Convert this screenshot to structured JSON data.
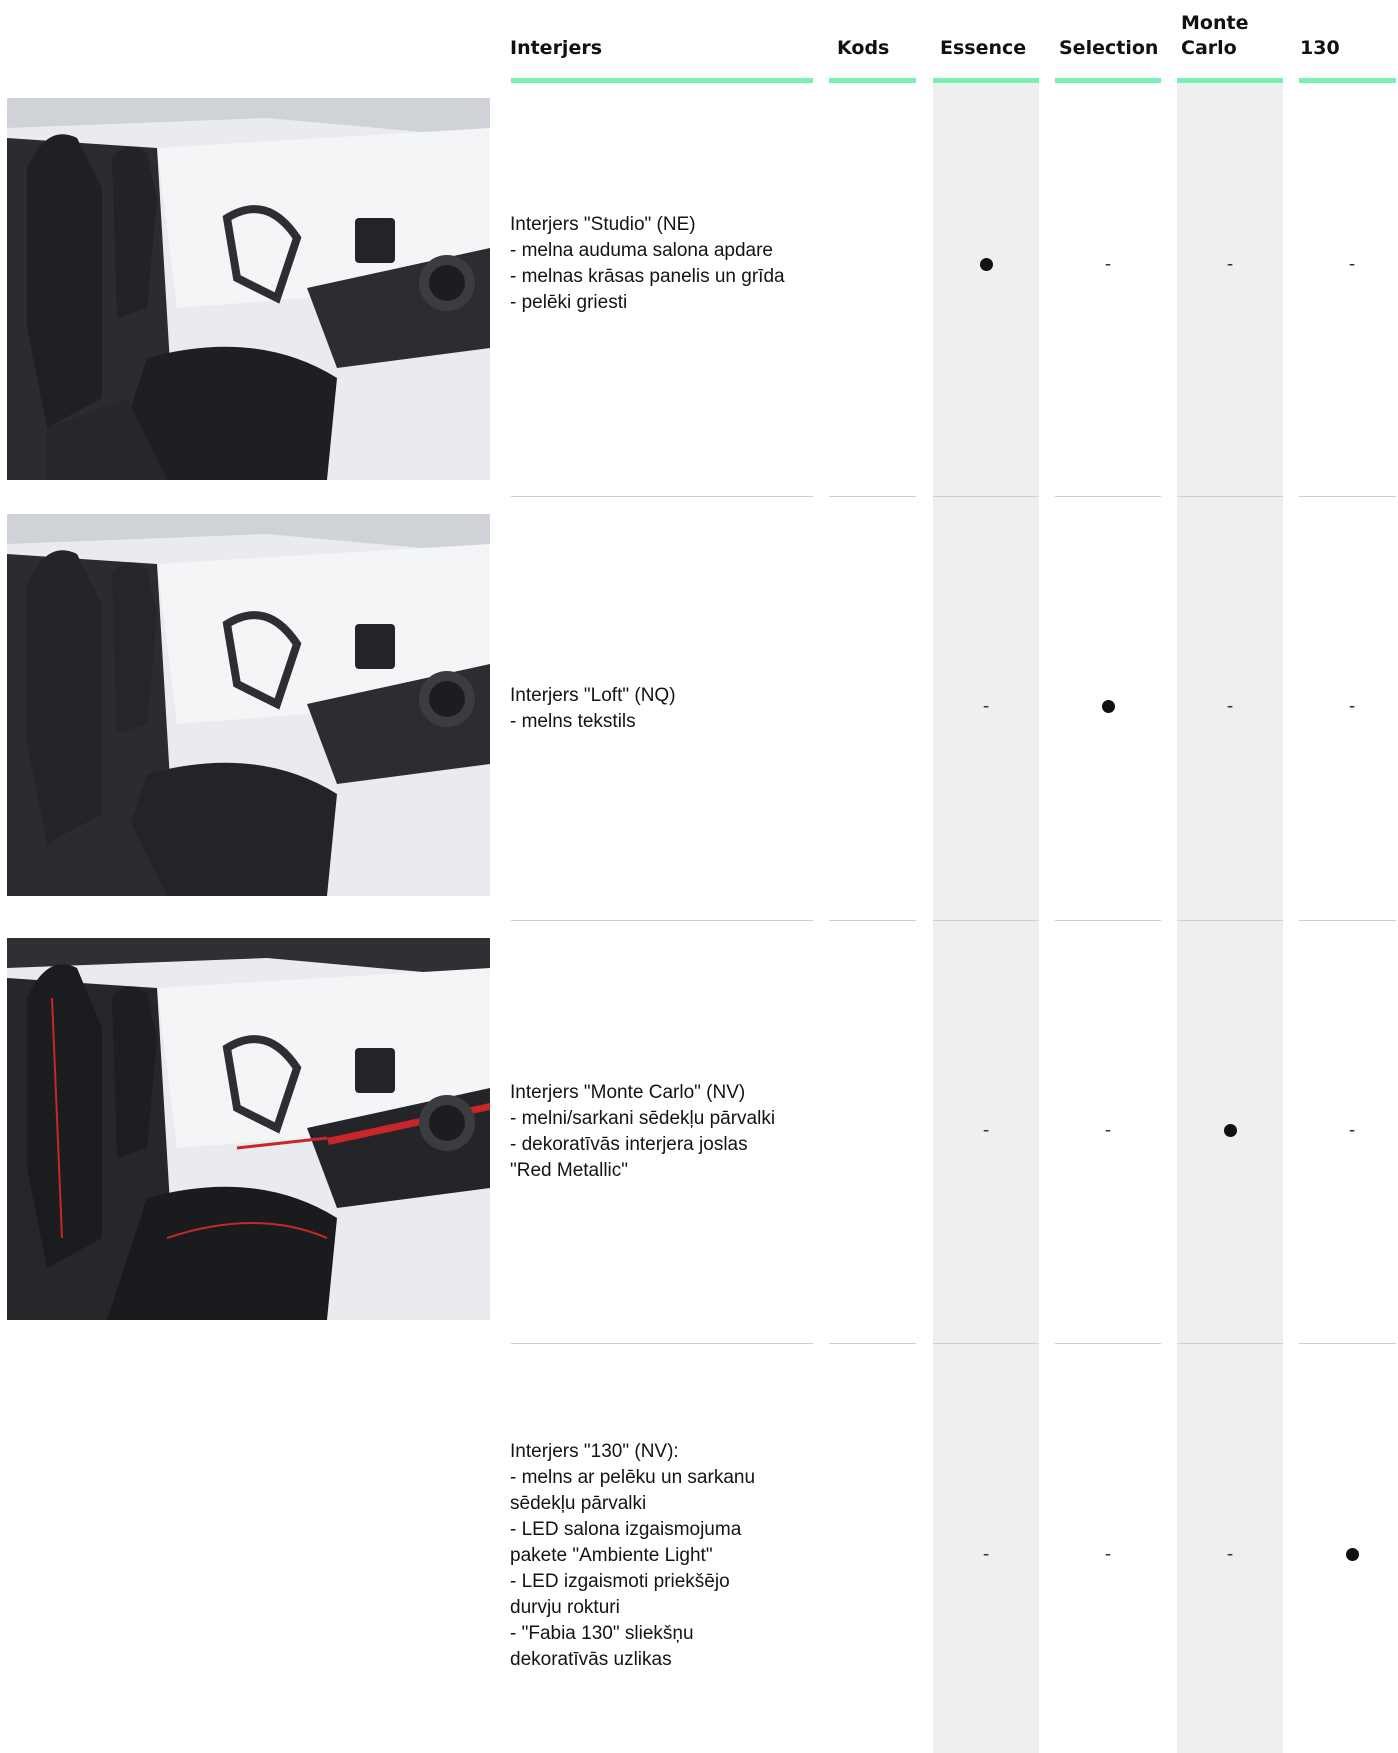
{
  "header": {
    "interior": "Interjers",
    "code": "Kods",
    "essence": "Essence",
    "selection": "Selection",
    "monte_carlo_line1": "Monte",
    "monte_carlo_line2": "Carlo",
    "model_130": "130"
  },
  "colors": {
    "header_underline": "#78f0b4",
    "shaded_column": "#efefef",
    "accent_red": "#c8262a"
  },
  "rows": [
    {
      "description": "Interjers \"Studio\" (NE)\n- melna auduma salona apdare\n- melnas krāsas panelis un grīda\n- pelēki griesti",
      "code": "",
      "essence": "●",
      "selection": "-",
      "monte_carlo": "-",
      "model_130": "-",
      "image": "interior-studio-photo"
    },
    {
      "description": "Interjers \"Loft\" (NQ)\n- melns tekstils",
      "code": "",
      "essence": "-",
      "selection": "●",
      "monte_carlo": "-",
      "model_130": "-",
      "image": "interior-loft-photo"
    },
    {
      "description": "Interjers \"Monte Carlo\" (NV)\n- melni/sarkani sēdekļu pārvalki\n- dekoratīvās interjera joslas\n\"Red Metallic\"",
      "code": "",
      "essence": "-",
      "selection": "-",
      "monte_carlo": "●",
      "model_130": "-",
      "image": "interior-monte-carlo-photo"
    },
    {
      "description": "Interjers \"130\" (NV):\n- melns ar pelēku un sarkanu\nsēdekļu pārvalki\n- LED salona izgaismojuma\npakete \"Ambiente Light\"\n- LED izgaismoti priekšējo\ndurvju rokturi\n- \"Fabia 130\" sliekšņu\ndekoratīvās uzlikas",
      "code": "",
      "essence": "-",
      "selection": "-",
      "monte_carlo": "-",
      "model_130": "●"
    }
  ]
}
